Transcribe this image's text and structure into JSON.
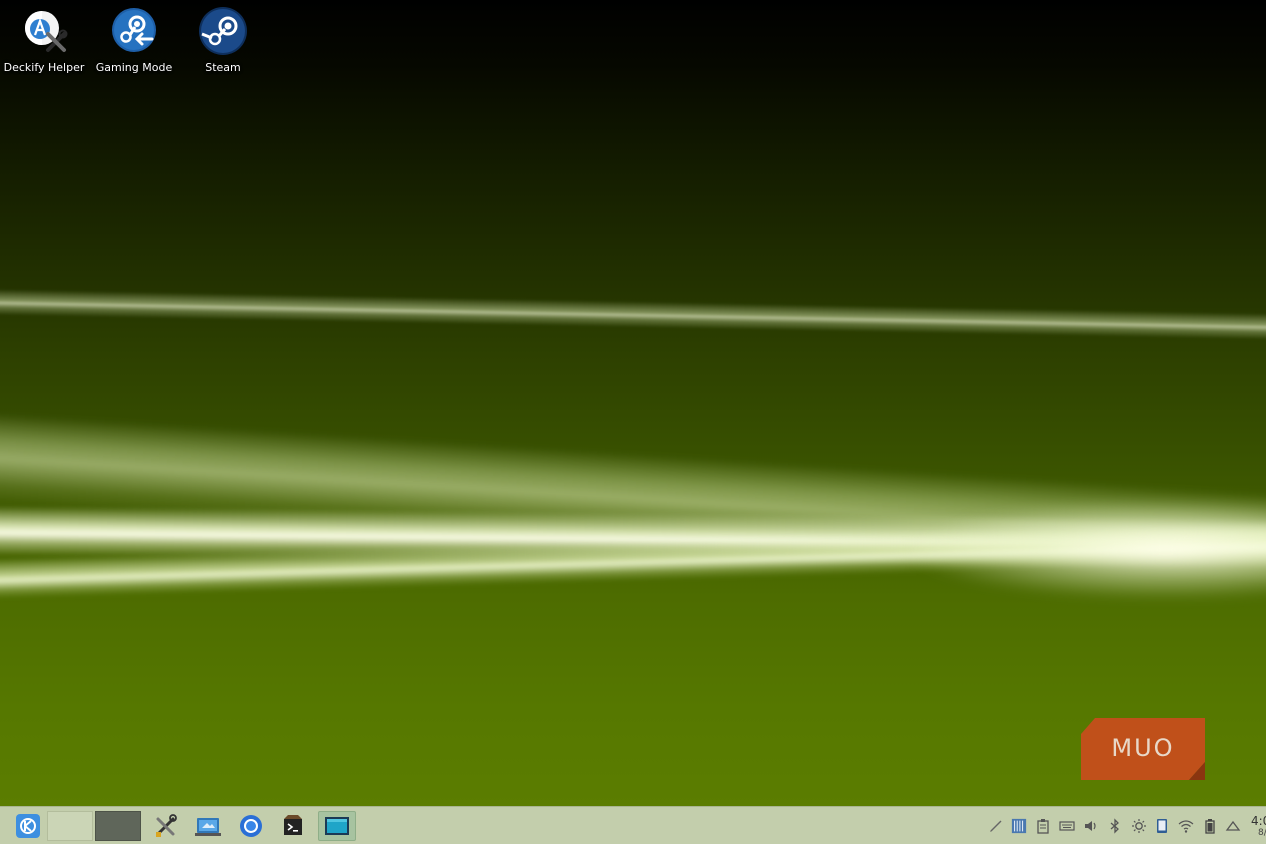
{
  "desktop": {
    "icons": [
      {
        "label": "Deckify Helper",
        "icon": "deckify-helper-icon"
      },
      {
        "label": "Gaming Mode",
        "icon": "steam-return-icon"
      },
      {
        "label": "Steam",
        "icon": "steam-icon"
      }
    ],
    "watermark": "MUO"
  },
  "taskbar": {
    "launcher_icon": "kde-launcher-icon",
    "pager_count": 2,
    "active_desktop": 2,
    "apps": [
      "system-settings-icon",
      "discover-icon",
      "chrome-icon",
      "terminal-icon",
      "dolphin-icon"
    ],
    "tray": [
      "pen-icon",
      "keyboard-layout-icon",
      "clipboard-icon",
      "keyboard-icon",
      "volume-icon",
      "bluetooth-icon",
      "brightness-icon",
      "tablet-icon",
      "wifi-icon",
      "battery-icon",
      "notifications-icon"
    ],
    "clock_time": "4:0",
    "clock_date": "8/"
  },
  "colors": {
    "taskbar_bg": "#c3ceac",
    "watermark_bg": "#c0501a",
    "steam_blue": "#1b4a8a"
  }
}
